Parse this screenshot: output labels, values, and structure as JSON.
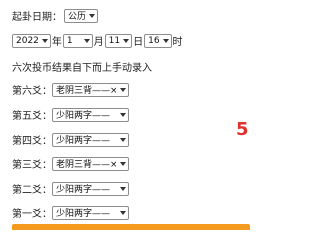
{
  "date_form": {
    "start_label": "起卦日期：",
    "calendar_select": "公历",
    "year": "2022",
    "year_unit": "年",
    "month": "1",
    "month_unit": "月",
    "day": "11",
    "day_unit": "日",
    "hour": "16",
    "hour_unit": "时"
  },
  "instruction": "六次投币结果自下而上手动录入",
  "yao_rows": [
    {
      "label": "第六爻：",
      "value": "老阴三背——×"
    },
    {
      "label": "第五爻：",
      "value": "少阳两字——"
    },
    {
      "label": "第四爻：",
      "value": "少阳两字——"
    },
    {
      "label": "第三爻：",
      "value": "老阴三背——×"
    },
    {
      "label": "第二爻：",
      "value": "少阳两字——"
    },
    {
      "label": "第一爻：",
      "value": "少阳两字——"
    }
  ],
  "brand_glyph": "5",
  "colors": {
    "accent": "#f39a1f",
    "brand": "#e0322f"
  }
}
